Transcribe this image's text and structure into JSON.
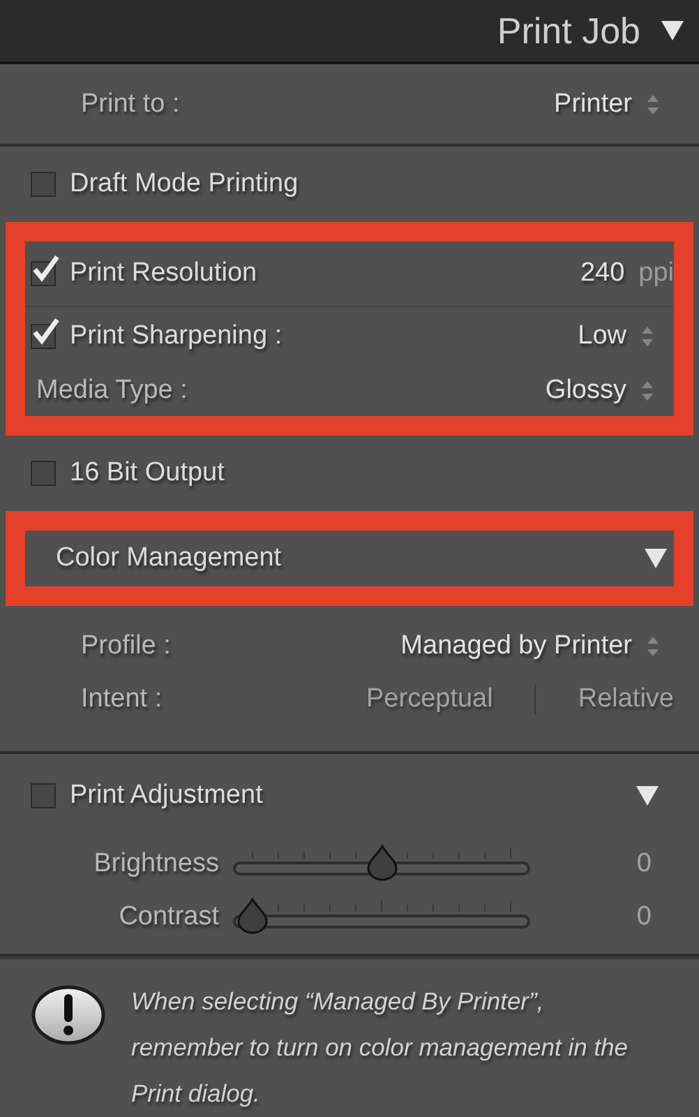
{
  "header": {
    "title": "Print Job",
    "expanded": true
  },
  "print_to": {
    "label": "Print to :",
    "value": "Printer"
  },
  "groups": [
    {
      "highlighted": false,
      "rows": [
        {
          "kind": "checkbox",
          "label": "Draft Mode Printing",
          "checked": false
        }
      ]
    },
    {
      "highlighted": true,
      "rows": [
        {
          "kind": "checkbox_value",
          "label": "Print Resolution",
          "checked": true,
          "value": "240",
          "unit": "ppi"
        },
        {
          "kind": "checkbox_select",
          "label": "Print Sharpening :",
          "checked": true,
          "value": "Low"
        },
        {
          "kind": "select",
          "label": "Media Type :",
          "value": "Glossy"
        }
      ]
    },
    {
      "highlighted": false,
      "rows": [
        {
          "kind": "checkbox",
          "label": "16 Bit Output",
          "checked": false
        }
      ]
    },
    {
      "highlighted": true,
      "rows": [
        {
          "kind": "section",
          "label": "Color Management",
          "expanded": true
        }
      ]
    },
    {
      "highlighted": false,
      "rows": [
        {
          "kind": "select",
          "label": "Profile :",
          "value": "Managed by Printer"
        },
        {
          "kind": "segmented",
          "label": "Intent :",
          "options": [
            {
              "label": "Perceptual",
              "selected": false
            },
            {
              "label": "Relative",
              "selected": false
            }
          ]
        }
      ]
    }
  ],
  "adjustment": {
    "label": "Print Adjustment",
    "checked": false,
    "expanded": true,
    "sliders": [
      {
        "label": "Brightness",
        "level": 0.5,
        "reading": "0"
      },
      {
        "label": "Contrast",
        "level": 0,
        "reading": "0"
      }
    ]
  },
  "notice": {
    "text": "When selecting “Managed By Printer”, remember to turn on color management in the Print dialog."
  }
}
